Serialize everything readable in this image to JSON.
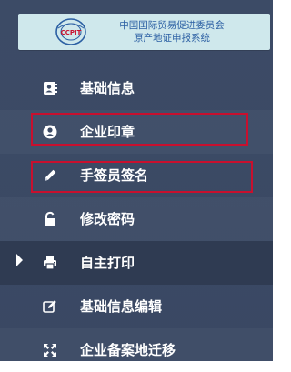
{
  "header": {
    "org_name": "中国国际贸易促进委员会",
    "system_name": "原产地证申报系统",
    "logo_text": "CCPIT",
    "logo_icon": "ccpit-logo"
  },
  "menu": {
    "items": [
      {
        "label": "基础信息",
        "icon": "contact-card-icon"
      },
      {
        "label": "企业印章",
        "icon": "user-circle-icon"
      },
      {
        "label": "手签员签名",
        "icon": "pencil-icon"
      },
      {
        "label": "修改密码",
        "icon": "unlock-icon"
      },
      {
        "label": "自主打印",
        "icon": "printer-icon",
        "active": true
      },
      {
        "label": "基础信息编辑",
        "icon": "edit-icon"
      },
      {
        "label": "企业备案地迁移",
        "icon": "move-arrows-icon"
      }
    ]
  },
  "colors": {
    "sidebar_bg": "#3c4b66",
    "active_bg": "#2f3b52",
    "logo_bg": "#cfe8ec",
    "logo_text": "#2b5fa3",
    "highlight": "#c8102e"
  }
}
